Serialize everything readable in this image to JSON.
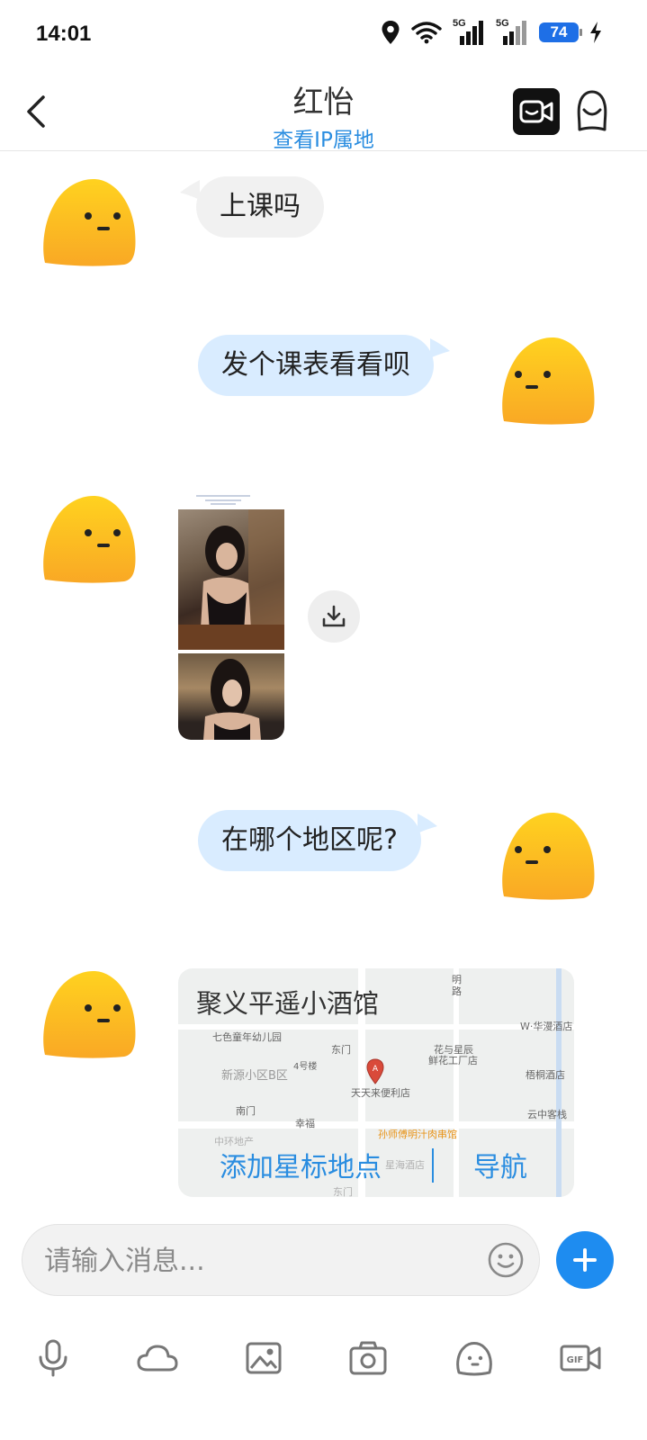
{
  "status_bar": {
    "time": "14:01",
    "network_1": "5G",
    "network_2": "5G",
    "battery": "74",
    "icons": [
      "location-icon",
      "wifi-icon",
      "signal-icon",
      "signal-icon",
      "battery-icon",
      "charging-icon"
    ]
  },
  "header": {
    "title": "红怡",
    "subtitle": "查看IP属地",
    "icons": [
      "back-icon",
      "video-call-icon",
      "profile-icon"
    ]
  },
  "messages": [
    {
      "side": "in",
      "text": "上课吗"
    },
    {
      "side": "out",
      "text": "发个课表看看呗"
    },
    {
      "side": "in",
      "type": "image"
    },
    {
      "side": "out",
      "text": "在哪个地区呢?"
    },
    {
      "side": "in",
      "type": "location"
    }
  ],
  "location": {
    "name": "聚义平遥小酒馆",
    "add_star": "添加星标地点",
    "navigate": "导航",
    "map_labels": {
      "kindergarten": "七色童年幼儿园",
      "east_gate": "东门",
      "community_b": "新源小区B区",
      "building4": "4号楼",
      "south_gate": "南门",
      "xingfu": "幸福",
      "store": "天天来便利店",
      "flower_factory_1": "花与星辰",
      "flower_factory_2": "鲜花工厂店",
      "hotel_w": "W·华漫酒店",
      "hotel_wutong": "梧桐酒店",
      "yunzhong": "云中客栈",
      "road": "明路",
      "bbq": "孙师傅明汁肉串馆",
      "center": "中环地产",
      "hotel_bottom": "星海酒店",
      "east_gate_2": "东门",
      "pin": "A"
    }
  },
  "input": {
    "placeholder": "请输入消息..."
  },
  "toolbar": {
    "icons": [
      "microphone-icon",
      "cloud-icon",
      "image-icon",
      "camera-icon",
      "sticker-icon",
      "gif-icon"
    ]
  },
  "colors": {
    "accent": "#2a8de0",
    "outgoing_bubble": "#d9ecff",
    "incoming_bubble": "#f1f1f1",
    "avatar": "#fbc02d",
    "plus_button": "#1e8cf0"
  }
}
